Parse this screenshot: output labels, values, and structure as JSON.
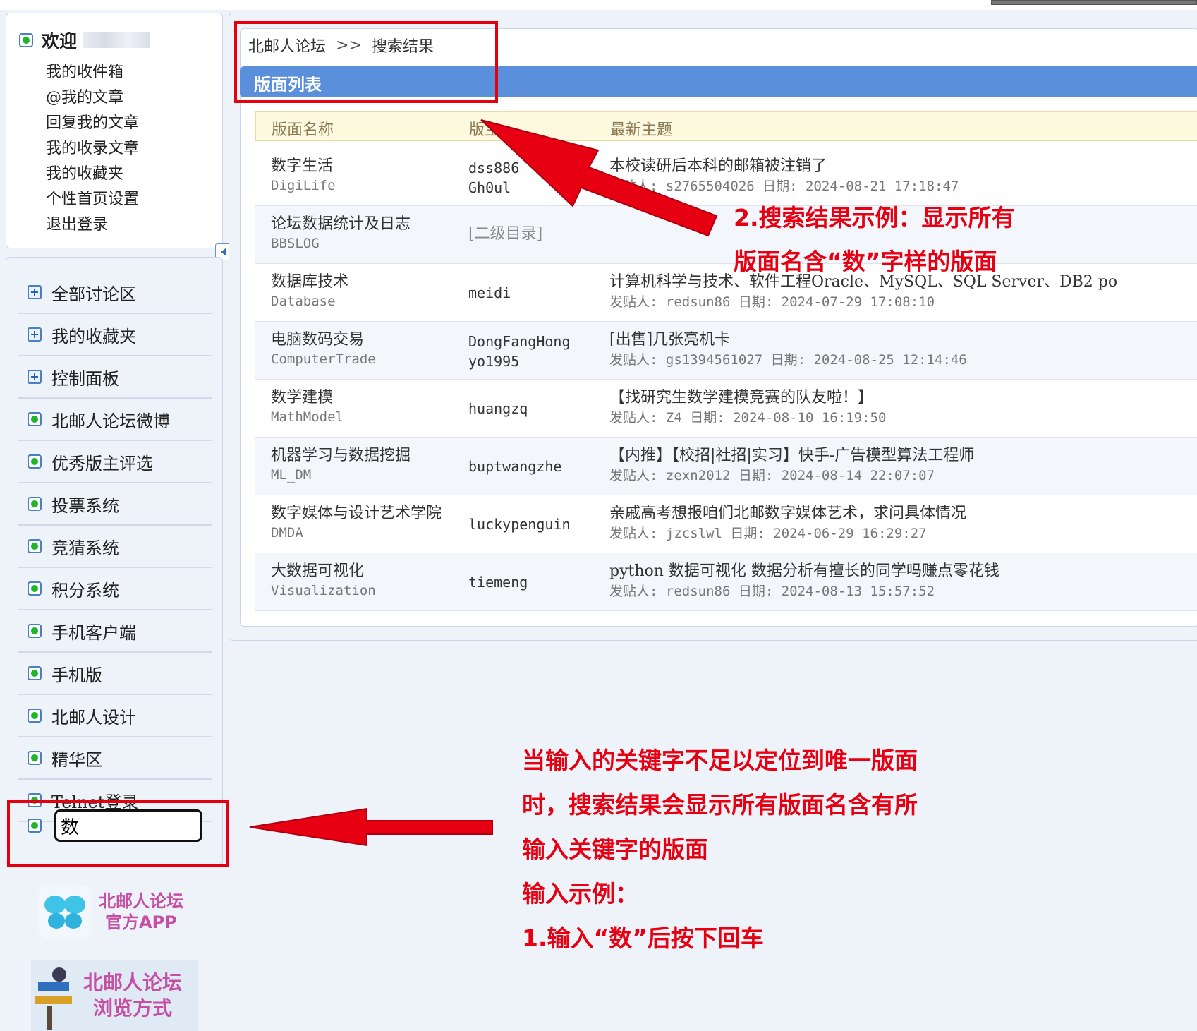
{
  "sidebar": {
    "welcome_title": "欢迎",
    "welcome_links": [
      "我的收件箱",
      "@我的文章",
      "回复我的文章",
      "我的收录文章",
      "我的收藏夹",
      "个性首页设置",
      "退出登录"
    ],
    "nav_items": [
      {
        "label": "全部讨论区",
        "icon": "plus-box-icon"
      },
      {
        "label": "我的收藏夹",
        "icon": "plus-box-icon"
      },
      {
        "label": "控制面板",
        "icon": "plus-box-icon"
      },
      {
        "label": "北邮人论坛微博",
        "icon": "green-dot-icon"
      },
      {
        "label": "优秀版主评选",
        "icon": "green-dot-icon"
      },
      {
        "label": "投票系统",
        "icon": "green-dot-icon"
      },
      {
        "label": "竞猜系统",
        "icon": "green-dot-icon"
      },
      {
        "label": "积分系统",
        "icon": "green-dot-icon"
      },
      {
        "label": "手机客户端",
        "icon": "green-dot-icon"
      },
      {
        "label": "手机版",
        "icon": "green-dot-icon"
      },
      {
        "label": "北邮人设计",
        "icon": "green-dot-icon"
      },
      {
        "label": "精华区",
        "icon": "green-dot-icon"
      },
      {
        "label": "Telnet登录",
        "icon": "green-dot-icon"
      }
    ],
    "search_value": "数",
    "app_badge": [
      "北邮人论坛",
      "官方APP"
    ],
    "browse_badge": [
      "北邮人论坛",
      "浏览方式"
    ]
  },
  "main": {
    "breadcrumb": [
      "北邮人论坛",
      ">>",
      "搜索结果"
    ],
    "section_title": "版面列表",
    "columns": [
      "版面名称",
      "版主",
      "最新主题"
    ],
    "rows": [
      {
        "name": "数字生活",
        "en": "DigiLife",
        "moderators": [
          "dss886",
          "Gh0ul"
        ],
        "topic": "本校读研后本科的邮箱被注销了",
        "meta": "发贴人: s2765504026 日期: 2024-08-21 17:18:47"
      },
      {
        "name": "论坛数据统计及日志",
        "en": "BBSLOG",
        "moderators": [
          "[二级目录]"
        ],
        "topic": "",
        "meta": ""
      },
      {
        "name": "数据库技术",
        "en": "Database",
        "moderators": [
          "meidi"
        ],
        "topic": "计算机科学与技术、软件工程Oracle、MySQL、SQL Server、DB2 po",
        "meta": "发贴人: redsun86 日期: 2024-07-29 17:08:10"
      },
      {
        "name": "电脑数码交易",
        "en": "ComputerTrade",
        "moderators": [
          "DongFangHong",
          "yo1995"
        ],
        "topic": "[出售]几张亮机卡",
        "meta": "发贴人: gs1394561027 日期: 2024-08-25 12:14:46"
      },
      {
        "name": "数学建模",
        "en": "MathModel",
        "moderators": [
          "huangzq"
        ],
        "topic": "【找研究生数学建模竞赛的队友啦！】",
        "meta": "发贴人: Z4 日期: 2024-08-10 16:19:50"
      },
      {
        "name": "机器学习与数据挖掘",
        "en": "ML_DM",
        "moderators": [
          "buptwangzhe"
        ],
        "topic": "【内推】【校招|社招|实习】快手-广告模型算法工程师",
        "meta": "发贴人: zexn2012 日期: 2024-08-14 22:07:07"
      },
      {
        "name": "数字媒体与设计艺术学院",
        "en": "DMDA",
        "moderators": [
          "luckypenguin"
        ],
        "topic": "亲戚高考想报咱们北邮数字媒体艺术，求问具体情况",
        "meta": "发贴人: jzcslwl 日期: 2024-06-29 16:29:27"
      },
      {
        "name": "大数据可视化",
        "en": "Visualization",
        "moderators": [
          "tiemeng"
        ],
        "topic": "python 数据可视化 数据分析有擅长的同学吗赚点零花钱",
        "meta": "发贴人: redsun86 日期: 2024-08-13 15:57:52"
      }
    ]
  },
  "annotations": {
    "result_note": [
      "2.搜索结果示例：显示所有",
      "版面名含“数”字样的版面"
    ],
    "input_note": [
      "当输入的关键字不足以定位到唯一版面",
      "时，搜索结果会显示所有版面名含有所",
      "输入关键字的版面",
      "输入示例：",
      "1.输入“数”后按下回车"
    ]
  },
  "colors": {
    "accent": "#5a8fdc",
    "annotation_red": "#e60012",
    "status_green": "#20b52a"
  }
}
